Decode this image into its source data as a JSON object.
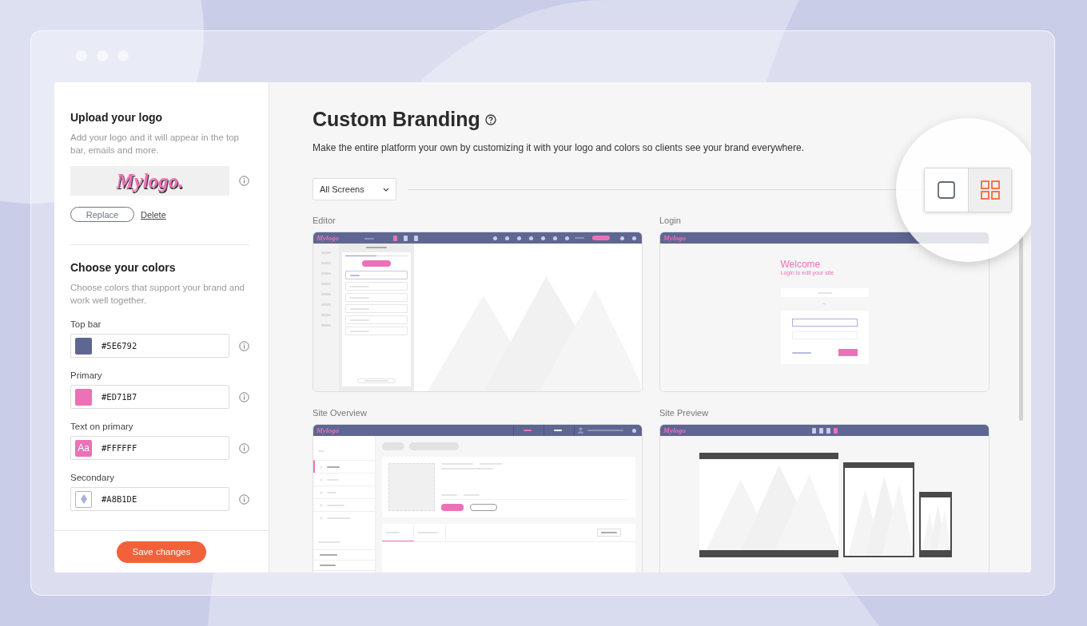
{
  "sidebar": {
    "logo_section": {
      "title": "Upload your logo",
      "description": "Add your logo and it will appear in the top bar, emails and more.",
      "logo": "Mylogo.",
      "replace_button": "Replace",
      "delete_link": "Delete"
    },
    "colors_section": {
      "title": "Choose your colors",
      "description": "Choose colors that support your brand and work well together.",
      "fields": [
        {
          "label": "Top bar",
          "value": "#5E6792",
          "kind": "fill",
          "color": "#5e6792"
        },
        {
          "label": "Primary",
          "value": "#ED71B7",
          "kind": "fill",
          "color": "#ed71b7"
        },
        {
          "label": "Text on primary",
          "value": "#FFFFFF",
          "kind": "text",
          "color": "#ed71b7",
          "sample": "Aa"
        },
        {
          "label": "Secondary",
          "value": "#A8B1DE",
          "kind": "outline",
          "color": "#a8b1de"
        }
      ]
    },
    "save_button": "Save changes"
  },
  "main": {
    "title": "Custom Branding",
    "description": "Make the entire platform your own by customizing it with your logo and colors so clients see your brand everywhere.",
    "filter": {
      "value": "All Screens"
    },
    "view_toggle": [
      {
        "kind": "single",
        "selected": false
      },
      {
        "kind": "grid",
        "selected": true
      }
    ],
    "previews": [
      {
        "label": "Editor",
        "kind": "editor",
        "logo": "Mylogo",
        "tabs": [
          {
            "selected": true
          },
          {
            "selected": false
          }
        ]
      },
      {
        "label": "Login",
        "kind": "login",
        "logo": "Mylogo",
        "heading": "Welcome",
        "subheading": "Login to edit your site"
      },
      {
        "label": "Site Overview",
        "kind": "overview",
        "logo": "Mylogo"
      },
      {
        "label": "Site Preview",
        "kind": "preview",
        "logo": "Mylogo"
      }
    ]
  }
}
